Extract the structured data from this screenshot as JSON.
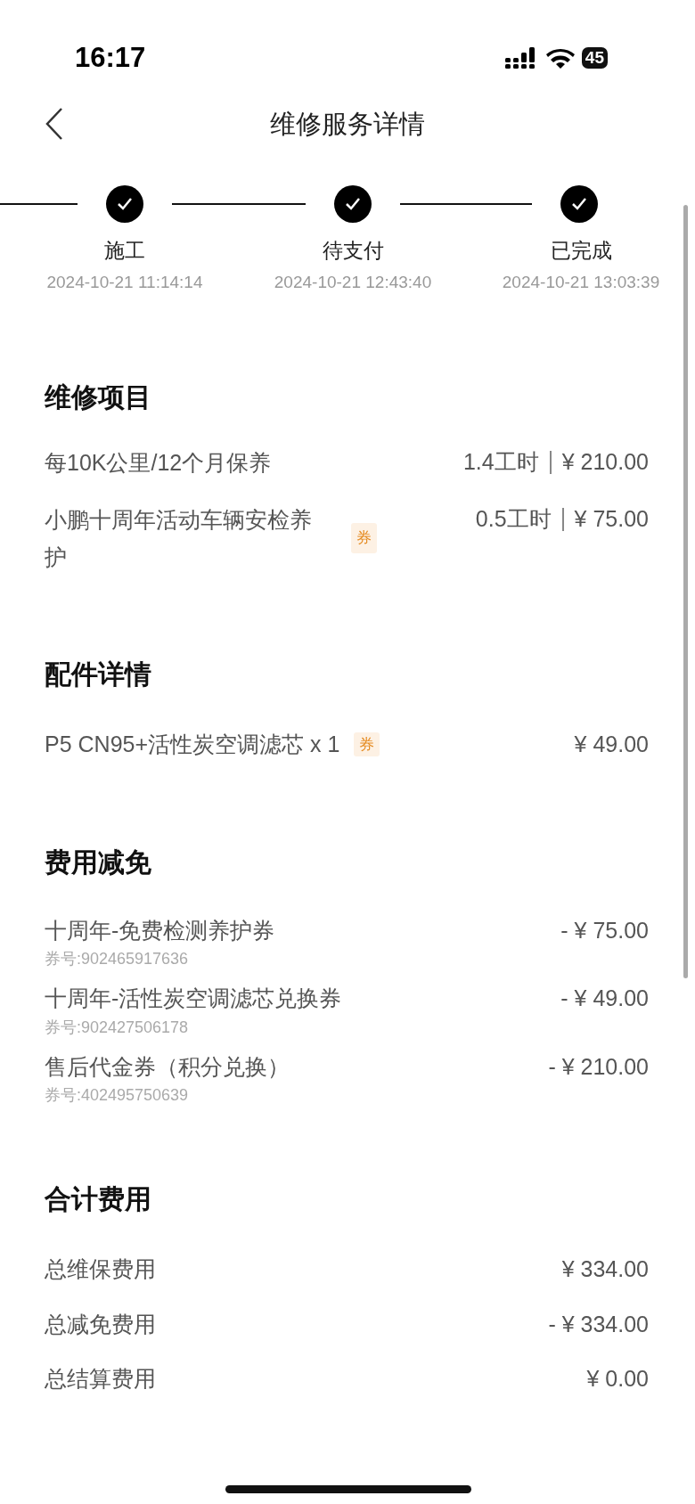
{
  "status_bar": {
    "time": "16:17",
    "battery": "45"
  },
  "nav": {
    "title": "维修服务详情"
  },
  "steps": [
    {
      "label": "施工",
      "time": "2024-10-21 11:14:14",
      "done": true
    },
    {
      "label": "待支付",
      "time": "2024-10-21 12:43:40",
      "done": true
    },
    {
      "label": "已完成",
      "time": "2024-10-21 13:03:39",
      "done": true
    }
  ],
  "repair_items": {
    "title": "维修项目",
    "rows": [
      {
        "name": "每10K公里/12个月保养",
        "hours": "1.4工时",
        "price": "¥ 210.00"
      },
      {
        "name": "小鹏十周年活动车辆安检养护",
        "tag": "券",
        "hours": "0.5工时",
        "price": "¥ 75.00"
      }
    ]
  },
  "parts": {
    "title": "配件详情",
    "rows": [
      {
        "name": "P5 CN95+活性炭空调滤芯 x 1",
        "tag": "券",
        "price": "¥ 49.00"
      }
    ]
  },
  "discounts": {
    "title": "费用减免",
    "rows": [
      {
        "name": "十周年-免费检测养护券",
        "code": "券号:902465917636",
        "amount": "- ¥ 75.00"
      },
      {
        "name": "十周年-活性炭空调滤芯兑换券",
        "code": "券号:902427506178",
        "amount": "- ¥ 49.00"
      },
      {
        "name": "售后代金券（积分兑换）",
        "code": "券号:402495750639",
        "amount": "- ¥ 210.00"
      }
    ]
  },
  "totals": {
    "title": "合计费用",
    "rows": [
      {
        "label": "总维保费用",
        "amount": "¥ 334.00"
      },
      {
        "label": "总减免费用",
        "amount": "- ¥ 334.00"
      },
      {
        "label": "总结算费用",
        "amount": "¥ 0.00"
      }
    ]
  }
}
